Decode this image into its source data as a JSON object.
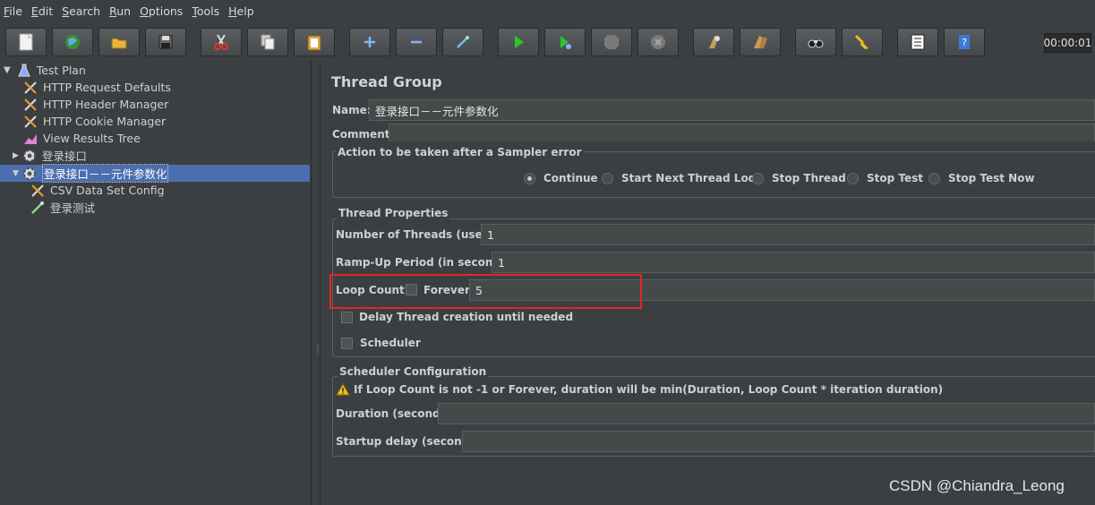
{
  "menu": [
    {
      "mn": "F",
      "rest": "ile"
    },
    {
      "mn": "E",
      "rest": "dit"
    },
    {
      "mn": "S",
      "rest": "earch"
    },
    {
      "mn": "R",
      "rest": "un"
    },
    {
      "mn": "O",
      "rest": "ptions"
    },
    {
      "mn": "T",
      "rest": "ools"
    },
    {
      "mn": "H",
      "rest": "elp"
    }
  ],
  "toolbar": {
    "buttons": [
      "new",
      "templates",
      "open",
      "save",
      "cut",
      "copy",
      "paste",
      "expand",
      "collapse",
      "toggle",
      "start",
      "start-no-pauses",
      "stop",
      "shutdown",
      "clear",
      "clear-all",
      "search",
      "reset-search",
      "function-helper",
      "help"
    ],
    "timer": "00:00:01"
  },
  "tree": {
    "test_plan": "Test Plan",
    "http_request_defaults": "HTTP Request Defaults",
    "http_header_manager": "HTTP Header Manager",
    "http_cookie_manager": "HTTP Cookie Manager",
    "view_results_tree": "View Results Tree",
    "thread_group_1": "登录接口",
    "thread_group_2": "登录接口－－元件参数化",
    "csv_data_set_config": "CSV Data Set Config",
    "sampler_login_test": "登录测试"
  },
  "panel": {
    "title": "Thread Group",
    "name_label": "Name:",
    "name_value": "登录接口－－元件参数化",
    "comments_label": "Comments:",
    "sampler_error_title": "Action to be taken after a Sampler error",
    "sampler_error_options": [
      "Continue",
      "Start Next Thread Loop",
      "Stop Thread",
      "Stop Test",
      "Stop Test Now"
    ],
    "sampler_error_selected": "Continue",
    "thread_props_title": "Thread Properties",
    "num_threads_label": "Number of Threads (users):",
    "num_threads_value": "1",
    "rampup_label": "Ramp-Up Period (in seconds):",
    "rampup_value": "1",
    "loop_count_label": "Loop Count:",
    "forever_label": "Forever",
    "loop_count_value": "5",
    "delay_thread_label": "Delay Thread creation until needed",
    "scheduler_label": "Scheduler",
    "scheduler_config_title": "Scheduler Configuration",
    "scheduler_warning": "If Loop Count is not -1 or Forever, duration will be min(Duration, Loop Count * iteration duration)",
    "duration_label": "Duration (seconds)",
    "duration_value": "",
    "startup_delay_label": "Startup delay (seconds)",
    "startup_delay_value": ""
  },
  "watermark": "CSDN @Chiandra_Leong",
  "colors": {
    "background": "#3c3f41",
    "selection": "#4b6eaf",
    "highlight_box": "#e0262a"
  }
}
